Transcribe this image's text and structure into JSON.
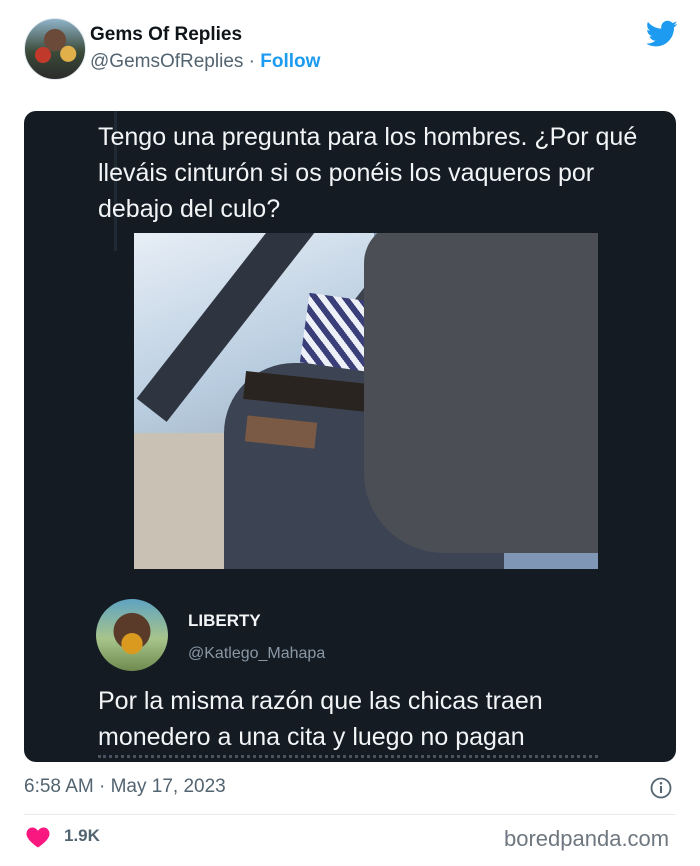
{
  "tweet": {
    "author_name": "Gems Of Replies",
    "author_handle": "@GemsOfReplies",
    "separator": "·",
    "follow_label": "Follow",
    "timestamp": "6:58 AM · May 17, 2023",
    "likes": "1.9K"
  },
  "embedded": {
    "question": "Tengo una pregunta para los hombres. ¿Por qué lleváis cinturón si os ponéis los vaqueros por debajo del culo?",
    "reply_name": "LIBERTY",
    "reply_handle": "@Katlego_Mahapa",
    "reply_text": "Por la misma razón que las chicas traen monedero a una cita y luego no pagan"
  },
  "footer": {
    "watermark": "boredpanda.com"
  },
  "icons": {
    "brand": "twitter-bird-icon",
    "info": "info-icon",
    "like": "heart-icon"
  },
  "colors": {
    "accent": "#1d9bf0",
    "like": "#f91880",
    "embed_bg": "#141b23"
  }
}
